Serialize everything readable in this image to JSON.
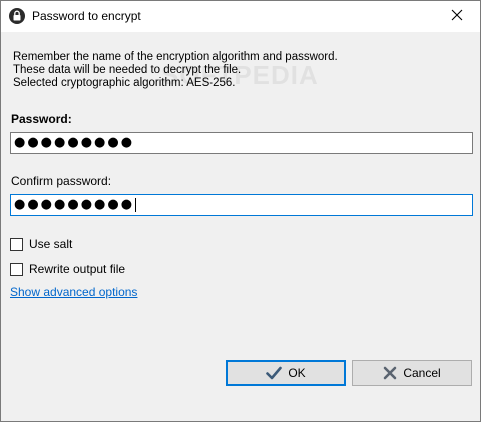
{
  "window": {
    "title": "Password to encrypt",
    "close_icon": "close-icon",
    "lock_icon": "lock-icon"
  },
  "info": {
    "line1": "Remember the name of the encryption algorithm and password.",
    "line2": "These data will be needed to decrypt the file.",
    "line3": "Selected cryptographic algorithm: AES-256."
  },
  "watermark": "SOFTPEDIA",
  "password": {
    "label": "Password:",
    "value": "●●●●●●●●●"
  },
  "confirm": {
    "label": "Confirm password:",
    "value": "●●●●●●●●●"
  },
  "options": {
    "use_salt": {
      "label": "Use salt",
      "checked": false
    },
    "rewrite_output": {
      "label": "Rewrite output file",
      "checked": false
    }
  },
  "advanced_link": "Show advanced options",
  "buttons": {
    "ok": "OK",
    "cancel": "Cancel"
  },
  "colors": {
    "accent": "#0078d7",
    "link": "#0066cc",
    "ok_check": "#3c5a78",
    "cancel_x": "#5a6470"
  }
}
